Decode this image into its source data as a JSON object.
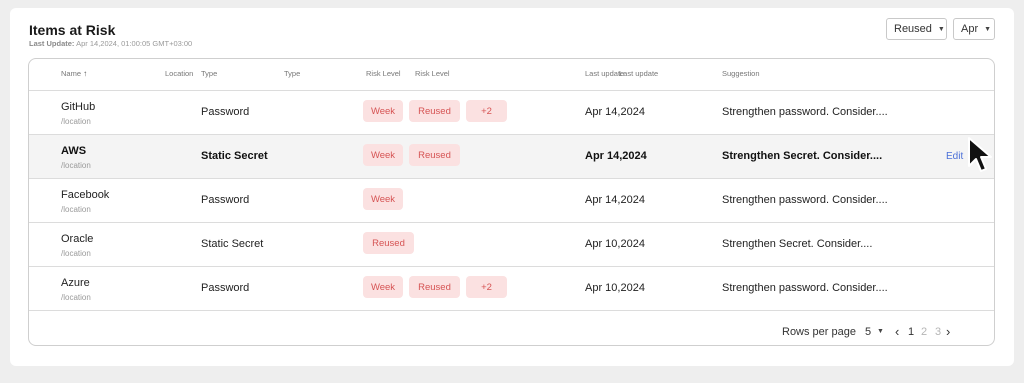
{
  "header": {
    "title": "Items at Risk",
    "last_update_label": "Last Update:",
    "last_update_value": "Apr 14,2024, 01:00:05 GMT+03:00"
  },
  "filters": {
    "risk_value": "Reused",
    "month_value": "Apr"
  },
  "columns": {
    "name": "Name",
    "name_sort": "↑",
    "location": "Location",
    "type": "Type",
    "type_overlap": "Type",
    "risk_level": "Risk Level",
    "risk_level_overlap": "Risk Level",
    "last_update": "Last update",
    "last_update_overlap": "Last update",
    "suggestion": "Suggestion"
  },
  "rows": [
    {
      "name": "GitHub",
      "location": "/location",
      "type": "Password",
      "badges": [
        "Week",
        "Reused",
        "+2"
      ],
      "last_update": "Apr 14,2024",
      "suggestion": "Strengthen password. Consider...."
    },
    {
      "name": "AWS",
      "location": "/location",
      "type": "Static Secret",
      "badges": [
        "Week",
        "Reused"
      ],
      "last_update": "Apr 14,2024",
      "suggestion": "Strengthen Secret. Consider....",
      "action": "Edit"
    },
    {
      "name": "Facebook",
      "location": "/location",
      "type": "Password",
      "badges": [
        "Week"
      ],
      "last_update": "Apr 14,2024",
      "suggestion": "Strengthen password. Consider...."
    },
    {
      "name": "Oracle",
      "location": "/location",
      "type": "Static Secret",
      "badges": [
        "Reused"
      ],
      "last_update": "Apr 10,2024",
      "suggestion": "Strengthen Secret. Consider...."
    },
    {
      "name": "Azure",
      "location": "/location",
      "type": "Password",
      "badges": [
        "Week",
        "Reused",
        "+2"
      ],
      "last_update": "Apr 10,2024",
      "suggestion": "Strengthen password. Consider...."
    }
  ],
  "pagination": {
    "rows_per_page_label": "Rows per page",
    "rows_per_page_value": "5",
    "pages": [
      "1",
      "2",
      "3"
    ],
    "current_page": "1"
  },
  "colors": {
    "badge_bg": "#fbe1e1",
    "badge_text": "#d65454",
    "link": "#4a6fd8"
  }
}
